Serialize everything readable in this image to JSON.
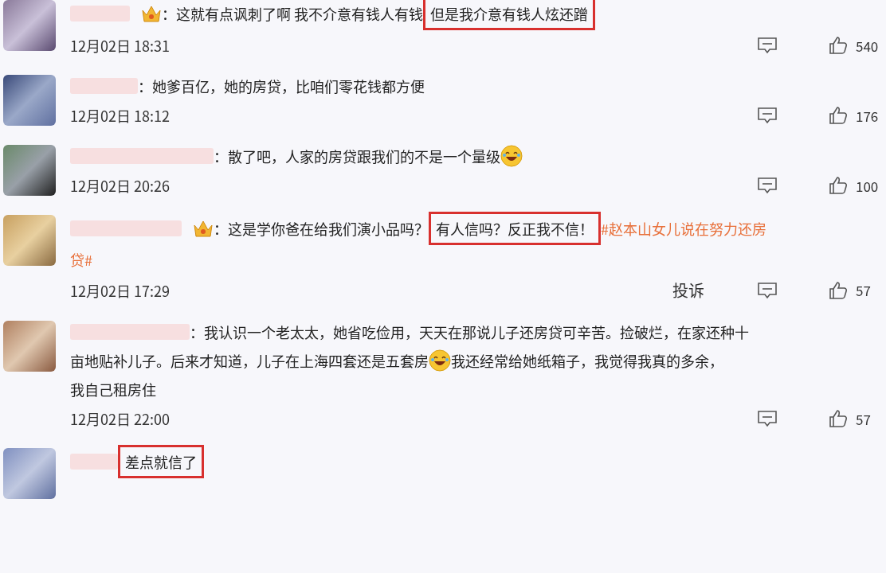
{
  "comments": [
    {
      "badge": true,
      "lines": [
        [
          {
            "kind": "text",
            "text": "：这就有点讽刺了啊 我不介意有钱人有钱"
          },
          {
            "kind": "highlight",
            "text": "但是我介意有钱人炫还蹭"
          }
        ]
      ],
      "time": "12月02日 18:31",
      "likes": "540"
    },
    {
      "badge": false,
      "lines": [
        [
          {
            "kind": "text",
            "text": "：她爹百亿，她的房贷，比咱们零花钱都方便"
          }
        ]
      ],
      "time": "12月02日 18:12",
      "likes": "176"
    },
    {
      "badge": false,
      "lines": [
        [
          {
            "kind": "text",
            "text": "：散了吧，人家的房贷跟我们的不是一个量级"
          },
          {
            "kind": "emoji"
          }
        ]
      ],
      "time": "12月02日 20:26",
      "likes": "100"
    },
    {
      "badge": true,
      "lines": [
        [
          {
            "kind": "text",
            "text": "：这是学你爸在给我们演小品吗？"
          },
          {
            "kind": "highlight",
            "text": "有人信吗？反正我不信！"
          },
          {
            "kind": "hashtag",
            "text": "#赵本山女儿说在努力还房"
          }
        ],
        [
          {
            "kind": "hashtag",
            "text": "贷#"
          }
        ]
      ],
      "time": "12月02日 17:29",
      "report": "投诉",
      "likes": "57"
    },
    {
      "badge": false,
      "lines": [
        [
          {
            "kind": "text",
            "text": "：我认识一个老太太，她省吃俭用，天天在那说儿子还房贷可辛苦。捡破烂，在家还种十"
          }
        ],
        [
          {
            "kind": "text",
            "text": "亩地贴补儿子。后来才知道，儿子在上海四套还是五套房"
          },
          {
            "kind": "emoji"
          },
          {
            "kind": "text",
            "text": "我还经常给她纸箱子，我觉得我真的多余，"
          }
        ],
        [
          {
            "kind": "text",
            "text": "我自己租房住"
          }
        ]
      ],
      "time": "12月02日 22:00",
      "likes": "57"
    },
    {
      "badge": false,
      "lines": [
        [
          {
            "kind": "highlight",
            "text": "差点就信了"
          }
        ]
      ]
    }
  ]
}
